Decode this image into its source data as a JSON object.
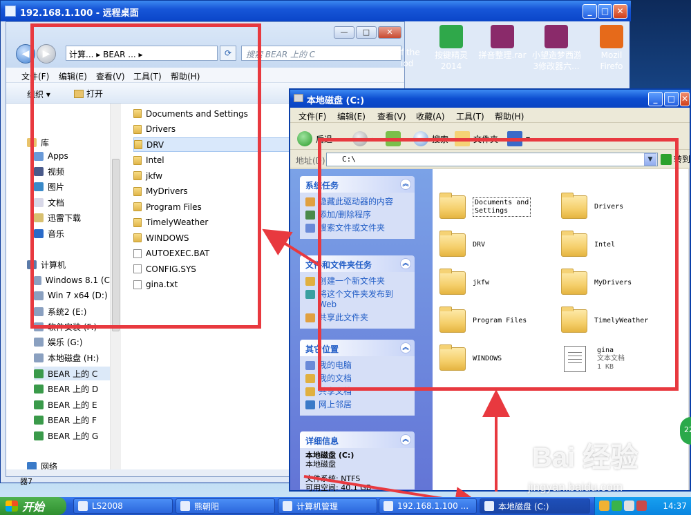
{
  "rdp": {
    "title": "192.168.1.100 - 远程桌面"
  },
  "desktop_icons": [
    {
      "label": "f the\niod",
      "color": "#7a5a2a"
    },
    {
      "label": "按键精灵\n2014",
      "color": "#2fa84a"
    },
    {
      "label": "拼音整理.rar",
      "color": "#8a2a6a"
    },
    {
      "label": "小望造梦西游\n3修改器六...",
      "color": "#8a2a6a"
    },
    {
      "label": "Mozil\nFirefo",
      "color": "#e66a1a"
    }
  ],
  "win7": {
    "address": "计算... ▸ BEAR ... ▸",
    "search_placeholder": "搜索 BEAR 上的 C",
    "menu": [
      "文件(F)",
      "编辑(E)",
      "查看(V)",
      "工具(T)",
      "帮助(H)"
    ],
    "organize": "组织 ▾",
    "open": "打开",
    "nav": [
      {
        "label": "库",
        "color": "#e9c36a"
      },
      {
        "label": "Apps",
        "color": "#6a9ad8"
      },
      {
        "label": "视频",
        "color": "#4a5a8a"
      },
      {
        "label": "图片",
        "color": "#3a8ac8"
      },
      {
        "label": "文档",
        "color": "#d8d8e8"
      },
      {
        "label": "迅雷下载",
        "color": "#d8c070"
      },
      {
        "label": "音乐",
        "color": "#2a6ac8"
      },
      {
        "label": "计算机",
        "color": "#5a7aa8"
      },
      {
        "label": "Windows 8.1 (C",
        "color": "#8aa0c0"
      },
      {
        "label": "Win 7 x64 (D:)",
        "color": "#8aa0c0"
      },
      {
        "label": "系统2 (E:)",
        "color": "#8aa0c0"
      },
      {
        "label": "软件安装 (F:)",
        "color": "#8aa0c0"
      },
      {
        "label": "娱乐 (G:)",
        "color": "#8aa0c0"
      },
      {
        "label": "本地磁盘 (H:)",
        "color": "#8aa0c0"
      },
      {
        "label": "BEAR 上的 C",
        "color": "#3a9a4a"
      },
      {
        "label": "BEAR 上的 D",
        "color": "#3a9a4a"
      },
      {
        "label": "BEAR 上的 E",
        "color": "#3a9a4a"
      },
      {
        "label": "BEAR 上的 F",
        "color": "#3a9a4a"
      },
      {
        "label": "BEAR 上的 G",
        "color": "#3a9a4a"
      },
      {
        "label": "网络",
        "color": "#3a7ac8"
      }
    ],
    "files": [
      {
        "name": "Documents and Settings",
        "type": "folder"
      },
      {
        "name": "Drivers",
        "type": "folder"
      },
      {
        "name": "DRV",
        "type": "folder",
        "selected": true
      },
      {
        "name": "Intel",
        "type": "folder"
      },
      {
        "name": "jkfw",
        "type": "folder"
      },
      {
        "name": "MyDrivers",
        "type": "folder"
      },
      {
        "name": "Program Files",
        "type": "folder"
      },
      {
        "name": "TimelyWeather",
        "type": "folder"
      },
      {
        "name": "WINDOWS",
        "type": "folder"
      },
      {
        "name": "AUTOEXEC.BAT",
        "type": "file"
      },
      {
        "name": "CONFIG.SYS",
        "type": "file"
      },
      {
        "name": "gina.txt",
        "type": "file"
      }
    ],
    "bottom_label": "器7"
  },
  "xp": {
    "title": "本地磁盘 (C:)",
    "menu": [
      "文件(F)",
      "编辑(E)",
      "查看(V)",
      "收藏(A)",
      "工具(T)",
      "帮助(H)"
    ],
    "toolbar": {
      "back": "后退 ·",
      "search": "搜索",
      "folders": "文件夹"
    },
    "address_label": "地址(D)",
    "address": "C:\\",
    "go": "转到",
    "panels": {
      "system": {
        "title": "系统任务",
        "links": [
          "隐藏此驱动器的内容",
          "添加/删除程序",
          "搜索文件或文件夹"
        ]
      },
      "file": {
        "title": "文件和文件夹任务",
        "links": [
          "创建一个新文件夹",
          "将这个文件夹发布到 Web",
          "共享此文件夹"
        ]
      },
      "other": {
        "title": "其它位置",
        "links": [
          "我的电脑",
          "我的文档",
          "共享文档",
          "网上邻居"
        ]
      },
      "details": {
        "title": "详细信息",
        "name": "本地磁盘 (C:)",
        "type": "本地磁盘",
        "fs": "文件系统: NTFS",
        "free": "可用空间: 40.1 GB"
      }
    },
    "items": [
      {
        "name": "Documents and\nSettings",
        "type": "folder"
      },
      {
        "name": "Drivers",
        "type": "folder"
      },
      {
        "name": "DRV",
        "type": "folder"
      },
      {
        "name": "Intel",
        "type": "folder"
      },
      {
        "name": "jkfw",
        "type": "folder"
      },
      {
        "name": "MyDrivers",
        "type": "folder"
      },
      {
        "name": "Program Files",
        "type": "folder"
      },
      {
        "name": "TimelyWeather",
        "type": "folder"
      },
      {
        "name": "WINDOWS",
        "type": "folder"
      },
      {
        "name": "gina",
        "type": "file",
        "sub1": "文本文档",
        "sub2": "1 KB"
      }
    ]
  },
  "taskbar": {
    "start": "开始",
    "tasks": [
      "LS2008",
      "熊朝阳",
      "计算机管理",
      "192.168.1.100 ...",
      "本地磁盘 (C:)"
    ],
    "clock": "14:37"
  },
  "watermark": {
    "logo": "Bai 经验",
    "url": "jingyan.baidu.com"
  },
  "side_badge": "22",
  "colors": {
    "annotation_red": "#e8393f",
    "xp_title_blue": "#0c4dd0",
    "xp_link": "#215dc6"
  }
}
